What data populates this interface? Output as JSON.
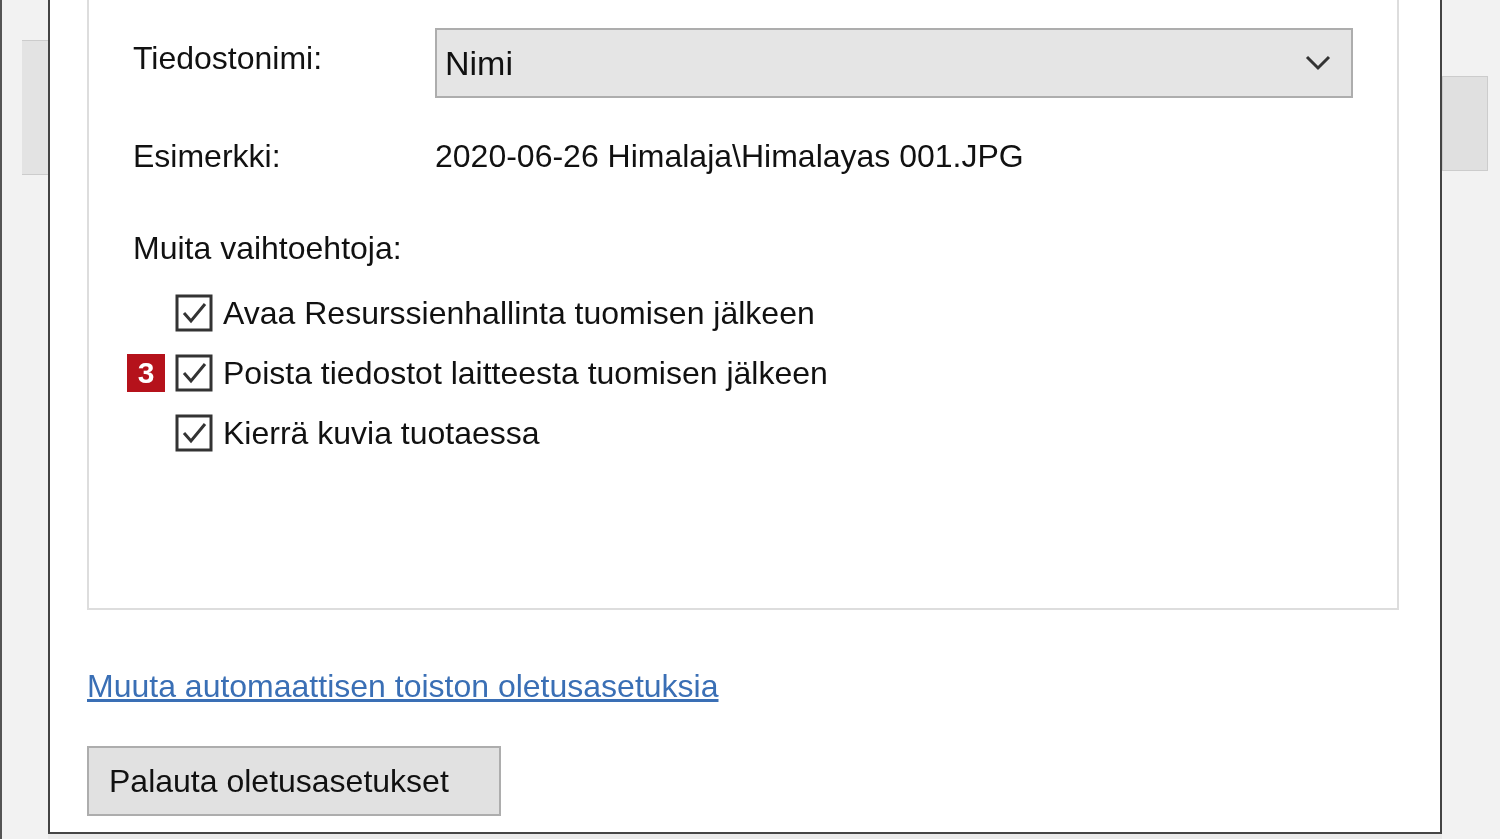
{
  "filename": {
    "label": "Tiedostonimi:",
    "value": "Nimi"
  },
  "example": {
    "label": "Esimerkki:",
    "value": "2020-06-26 Himalaja\\Himalayas 001.JPG"
  },
  "options_heading": "Muita vaihtoehtoja:",
  "options": [
    {
      "label": "Avaa Resurssienhallinta tuomisen jälkeen",
      "checked": true
    },
    {
      "label": "Poista tiedostot laitteesta tuomisen jälkeen",
      "checked": true,
      "badge": "3"
    },
    {
      "label": "Kierrä kuvia tuotaessa",
      "checked": true
    }
  ],
  "link": "Muuta automaattisen toiston oletusasetuksia",
  "button": "Palauta oletusasetukset"
}
